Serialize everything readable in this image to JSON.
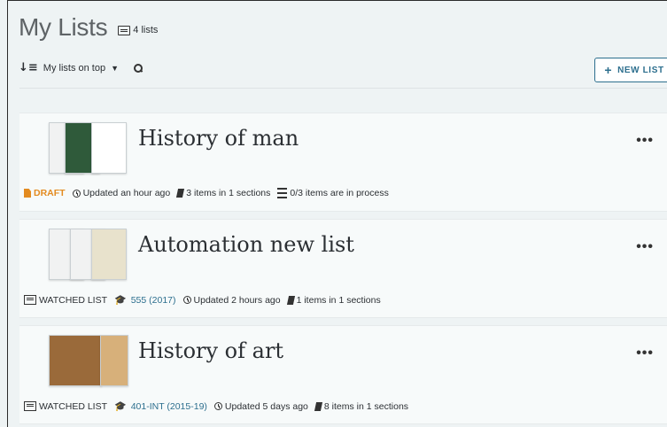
{
  "header": {
    "title": "My Lists",
    "count_label": "4 lists"
  },
  "toolbar": {
    "sort_label": "My lists on top",
    "new_list_label": "NEW LIST"
  },
  "lists": [
    {
      "title": "History of man",
      "status": "DRAFT",
      "updated": "Updated an hour ago",
      "items": "3 items in 1 sections",
      "process": "0/3 items are in process"
    },
    {
      "title": "Automation new list",
      "status": "WATCHED LIST",
      "course": "555 (2017)",
      "updated": "Updated 2 hours ago",
      "items": "1 items in 1 sections"
    },
    {
      "title": "History of art",
      "status": "WATCHED LIST",
      "course": "401-INT (2015-19)",
      "updated": "Updated 5 days ago",
      "items": "8 items in 1 sections"
    }
  ],
  "colors": {
    "accent": "#2d6f8e",
    "draft": "#e38b20",
    "background": "#eef3f4"
  },
  "icons": [
    "list-icon",
    "sort-icon",
    "caret-down-icon",
    "search-icon",
    "plus-icon",
    "more-icon",
    "draft-icon",
    "clock-icon",
    "book-icon",
    "graduation-cap-icon"
  ]
}
